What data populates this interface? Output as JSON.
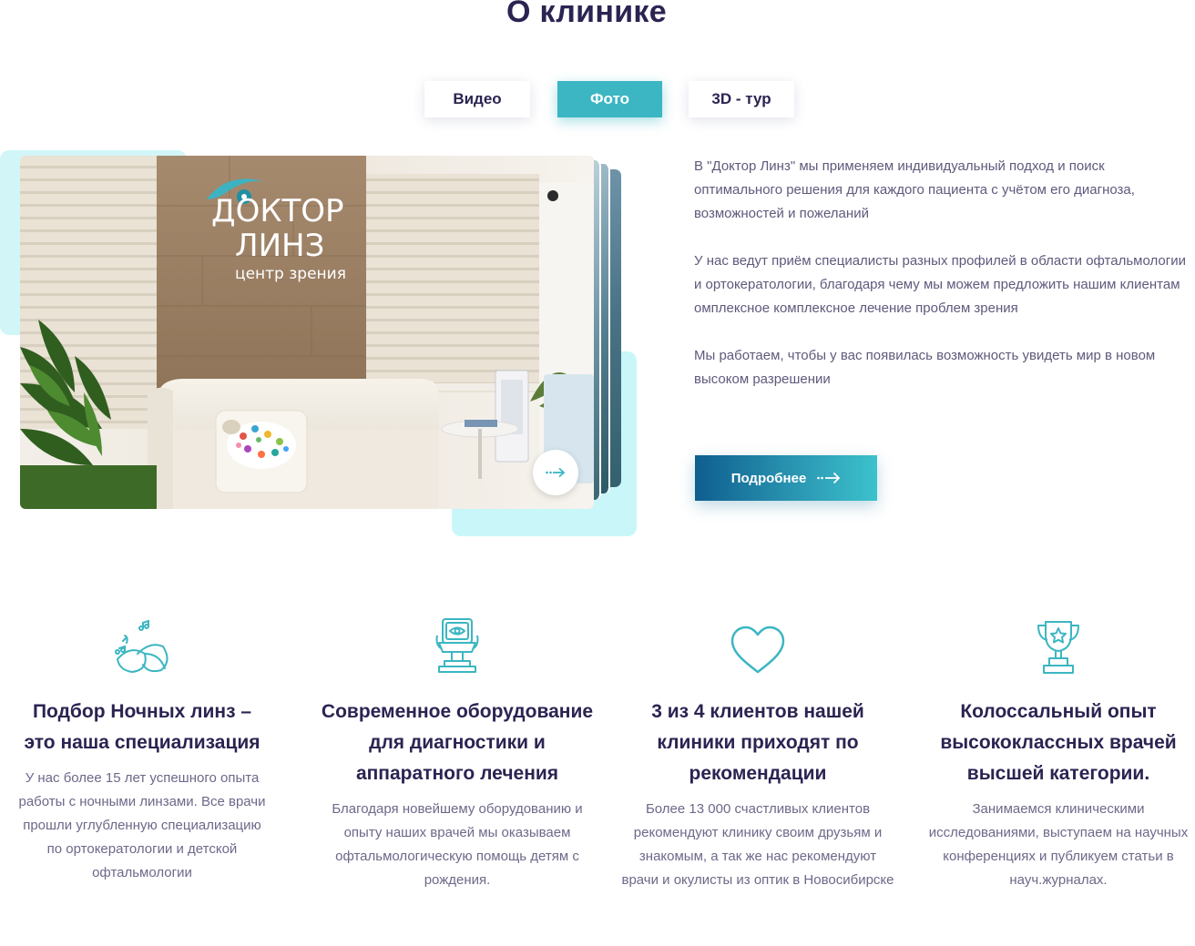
{
  "section": {
    "title": "О клинике"
  },
  "tabs": [
    {
      "label": "Видео",
      "active": false
    },
    {
      "label": "Фото",
      "active": true
    },
    {
      "label": "3D - тур",
      "active": false
    }
  ],
  "gallery": {
    "sign_line1": "ДОКТОР",
    "sign_line2": "ЛИНЗ",
    "sign_line3": "центр зрения",
    "next_icon": "arrow-right-icon"
  },
  "about": {
    "paragraphs": [
      "В \"Доктор Линз\" мы применяем индивидуальный подход и поиск оптимального решения для каждого пациента с учётом его диагноза, возможностей и пожеланий",
      "У нас ведут приём специалисты разных профилей в области офтальмологии и ортокератологии, благодаря чему мы можем предложить нашим клиентам омплексное комплексное лечение проблем зрения",
      "Мы работаем, чтобы у вас появилась возможность увидеть мир в новом высоком разрешении"
    ],
    "button_label": "Подробнее"
  },
  "features": [
    {
      "icon": "contact-lenses-icon",
      "title": "Подбор Ночных линз – это наша специализация",
      "text": "У нас более 15 лет успешного опыта работы с ночными линзами. Все врачи прошли углубленную специализацию по ортокератологии и детской офтальмологии"
    },
    {
      "icon": "eye-exam-device-icon",
      "title": "Современное оборудование для диагностики и аппаратного лечения",
      "text": "Благодаря новейшему оборудованию и опыту наших врачей мы оказываем офтальмологическую помощь детям с рождения."
    },
    {
      "icon": "heart-icon",
      "title": "3 из 4 клиентов нашей клиники приходят по рекомендации",
      "text": "Более 13 000 счастливых клиентов рекомендуют клинику своим друзьям и знакомым, а так же нас рекомендуют врачи и окулисты из оптик в Новосибирске"
    },
    {
      "icon": "trophy-icon",
      "title": "Колоссальный опыт высококлассных врачей высшей категории.",
      "text": "Занимаемся клиническими исследованиями, выступаем на научных конференциях и публикуем статьи в науч.журналах."
    }
  ],
  "colors": {
    "accent": "#3bb6c2",
    "heading": "#2a2452",
    "body_text": "#5e5a7c",
    "button_start": "#0f5e8f",
    "button_end": "#3cc2cc",
    "deco": "#d2f6f7"
  }
}
